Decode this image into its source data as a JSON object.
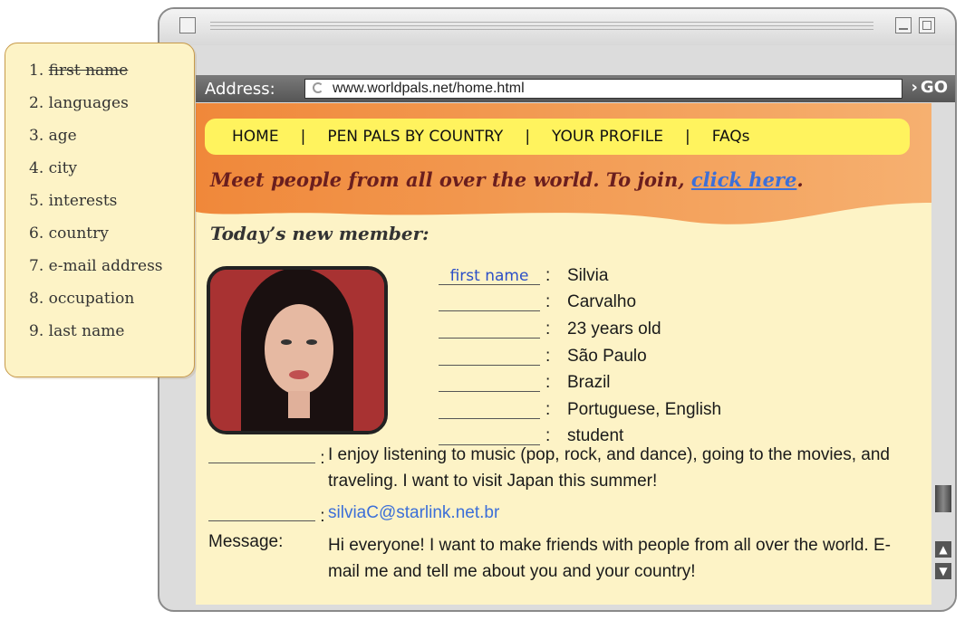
{
  "word_list": [
    {
      "num": "1.",
      "word": "first name",
      "used": true
    },
    {
      "num": "2.",
      "word": "languages",
      "used": false
    },
    {
      "num": "3.",
      "word": "age",
      "used": false
    },
    {
      "num": "4.",
      "word": "city",
      "used": false
    },
    {
      "num": "5.",
      "word": "interests",
      "used": false
    },
    {
      "num": "6.",
      "word": "country",
      "used": false
    },
    {
      "num": "7.",
      "word": "e-mail address",
      "used": false
    },
    {
      "num": "8.",
      "word": "occupation",
      "used": false
    },
    {
      "num": "9.",
      "word": "last name",
      "used": false
    }
  ],
  "browser": {
    "address_label": "Address:",
    "url": "www.worldpals.net/home.html",
    "go_label": "GO"
  },
  "nav": {
    "items": [
      "HOME",
      "PEN PALS BY COUNTRY",
      "YOUR PROFILE",
      "FAQs"
    ],
    "separator": "|"
  },
  "tagline": {
    "text": "Meet people from all over the world. To join,",
    "link": "click here",
    "suffix": "."
  },
  "new_member": {
    "heading": "Today’s new member:",
    "fields": [
      {
        "blank": "first name",
        "value": "Silvia"
      },
      {
        "blank": "",
        "value": "Carvalho"
      },
      {
        "blank": "",
        "value": "23 years old"
      },
      {
        "blank": "",
        "value": "São Paulo"
      },
      {
        "blank": "",
        "value": "Brazil"
      },
      {
        "blank": "",
        "value": "Portuguese, English"
      },
      {
        "blank": "",
        "value": "student"
      }
    ],
    "interests": "I enjoy listening to music (pop, rock, and dance), going to the movies, and traveling. I want to visit Japan this summer!",
    "email": "silviaC@starlink.net.br",
    "message_label": "Message:",
    "message": "Hi everyone! I want to make friends with people from all over the world. E-mail me and tell me about you and your country!"
  },
  "colors": {
    "banner": "#f08c3c",
    "nav_bar": "#fff35e",
    "page_bg": "#fdf3c6",
    "link": "#3c6fd8"
  }
}
